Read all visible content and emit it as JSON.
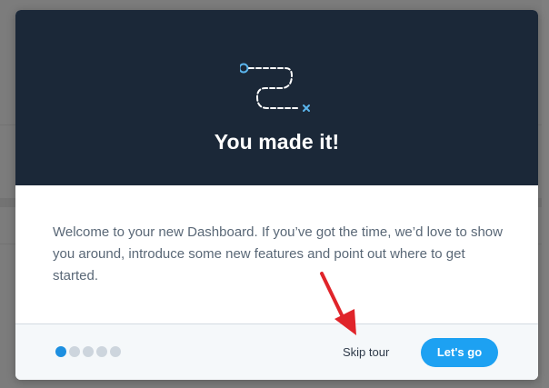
{
  "modal": {
    "title": "You made it!",
    "message": "Welcome to your new Dashboard. If you’ve got the time, we’d love to show you around, introduce some new features and point out where to get started.",
    "skip_label": "Skip tour",
    "primary_label": "Let's go",
    "steps_total": 5,
    "current_step": 1,
    "illustration_icon": "route-path-icon"
  },
  "annotation": {
    "arrow_icon": "red-arrow-icon",
    "arrow_color": "#e0242a"
  },
  "colors": {
    "header_bg": "#1b2838",
    "accent": "#1da1f2",
    "active_dot": "#1d8fe0",
    "inactive_dot": "#cdd5dd"
  }
}
